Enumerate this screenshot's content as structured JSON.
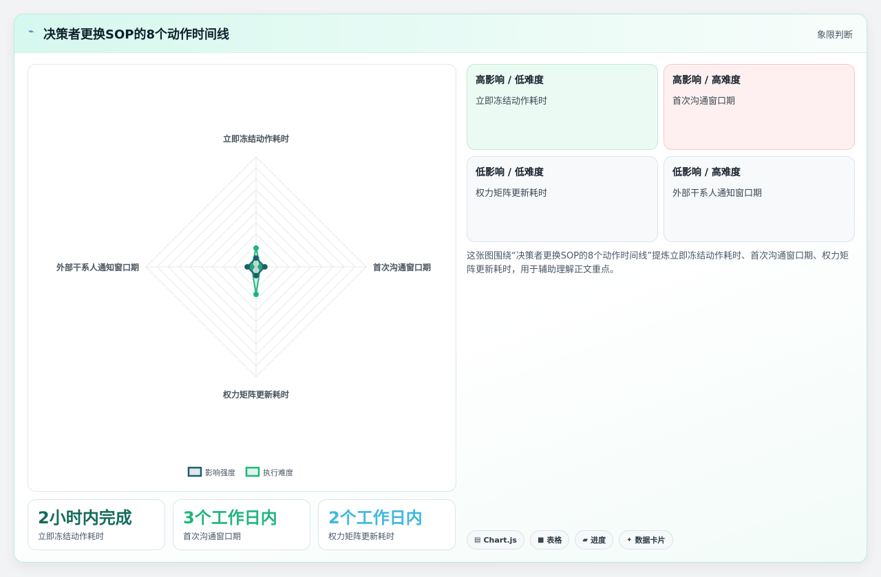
{
  "header": {
    "icon": "chart-line-icon",
    "title": "决策者更换SOP的8个动作时间线",
    "right_label": "象限判断"
  },
  "colors": {
    "impact": "#1c5f6b",
    "difficulty": "#1fb57e",
    "stat1": "#136b5c",
    "stat2": "#1fb57e",
    "stat3": "#3fb8e0"
  },
  "chart_data": {
    "type": "radar",
    "axes": [
      "立即冻结动作耗时",
      "首次沟通窗口期",
      "权力矩阵更新耗时",
      "外部干系人通知窗口期"
    ],
    "scale": [
      0,
      10
    ],
    "grid_levels": 10,
    "series": [
      {
        "name": "影响强度",
        "values": [
          0.8,
          0.8,
          0.8,
          0.8
        ],
        "color": "#1c5f6b"
      },
      {
        "name": "执行难度",
        "values": [
          1.7,
          0.4,
          2.5,
          0.4
        ],
        "color": "#1fb57e"
      }
    ],
    "legend_position": "bottom"
  },
  "quadrants": [
    {
      "title": "高影响 / 低难度",
      "item": "立即冻结动作耗时"
    },
    {
      "title": "高影响 / 高难度",
      "item": "首次沟通窗口期"
    },
    {
      "title": "低影响 / 低难度",
      "item": "权力矩阵更新耗时"
    },
    {
      "title": "低影响 / 高难度",
      "item": "外部干系人通知窗口期"
    }
  ],
  "description": "这张图围绕“决策者更换SOP的8个动作时间线”提炼立即冻结动作耗时、首次沟通窗口期、权力矩阵更新耗时，用于辅助理解正文重点。",
  "stats": [
    {
      "value": "2小时内完成",
      "label": "立即冻结动作耗时"
    },
    {
      "value": "3个工作日内",
      "label": "首次沟通窗口期"
    },
    {
      "value": "2个工作日内",
      "label": "权力矩阵更新耗时"
    }
  ],
  "tags": [
    {
      "icon": "chart-icon",
      "glyph": "▤",
      "label": "Chart.js"
    },
    {
      "icon": "table-icon",
      "glyph": "■",
      "label": "表格"
    },
    {
      "icon": "progress-icon",
      "glyph": "▰",
      "label": "进度"
    },
    {
      "icon": "sparkle-icon",
      "glyph": "✦",
      "label": "数据卡片"
    }
  ]
}
